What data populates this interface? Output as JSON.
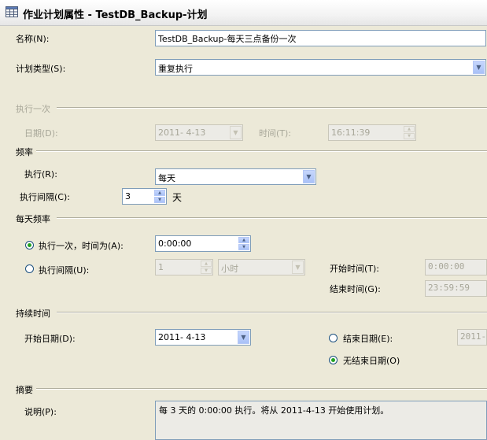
{
  "window": {
    "title": "作业计划属性 - TestDB_Backup-计划",
    "icon": "grid-icon"
  },
  "name": {
    "label": "名称(N):",
    "value": "TestDB_Backup-每天三点备份一次"
  },
  "schedule_type": {
    "label": "计划类型(S):",
    "value": "重复执行"
  },
  "one_time": {
    "section": "执行一次",
    "date_label": "日期(D):",
    "date_value": "2011- 4-13",
    "time_label": "时间(T):",
    "time_value": "16:11:39"
  },
  "frequency": {
    "section": "频率",
    "occurs_label": "执行(R):",
    "occurs_value": "每天",
    "interval_label": "执行间隔(C):",
    "interval_value": "3",
    "interval_unit": "天"
  },
  "daily_frequency": {
    "section": "每天频率",
    "once_label": "执行一次，时间为(A):",
    "once_value": "0:00:00",
    "once_selected": true,
    "every_label": "执行间隔(U):",
    "every_value": "1",
    "every_unit": "小时",
    "every_selected": false,
    "start_label": "开始时间(T):",
    "start_value": "0:00:00",
    "end_label": "结束时间(G):",
    "end_value": "23:59:59"
  },
  "duration": {
    "section": "持续时间",
    "start_date_label": "开始日期(D):",
    "start_date_value": "2011- 4-13",
    "end_date_label": "结束日期(E):",
    "end_date_value": "2011-",
    "end_date_selected": false,
    "no_end_label": "无结束日期(O)",
    "no_end_selected": true
  },
  "summary": {
    "section": "摘要",
    "desc_label": "说明(P):",
    "desc_value": "每 3 天的 0:00:00 执行。将从 2011-4-13 开始使用计划。"
  }
}
